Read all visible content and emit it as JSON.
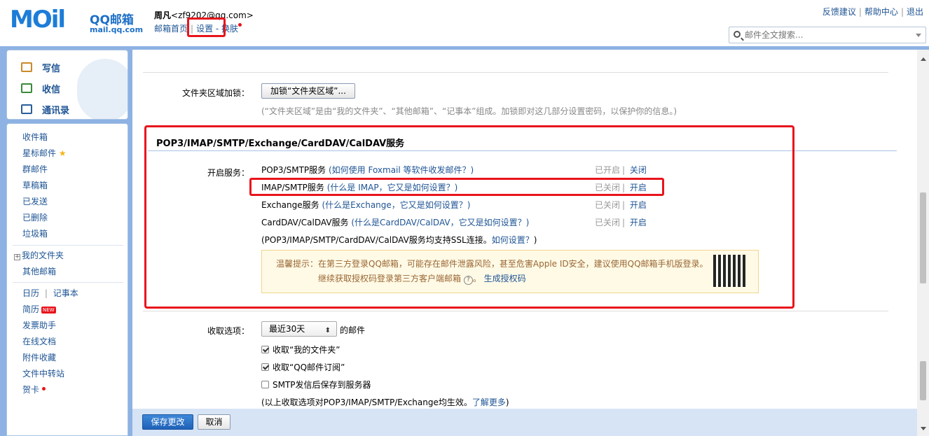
{
  "brand": {
    "mail_text": "MOil",
    "qq_mail": "QQ邮箱",
    "domain": "mail.qq.com"
  },
  "user": {
    "name": "周凡",
    "email": "<zf9202@qq.com>"
  },
  "toplinks": {
    "home": "邮箱首页",
    "settings": "设置",
    "skin": "换肤"
  },
  "rightlinks": {
    "feedback": "反馈建议",
    "help": "帮助中心",
    "logout": "退出"
  },
  "search": {
    "placeholder": "邮件全文搜索..."
  },
  "side": {
    "compose": "写信",
    "receive": "收信",
    "contacts": "通讯录",
    "items": {
      "inbox": "收件箱",
      "starred": "星标邮件",
      "group": "群邮件",
      "drafts": "草稿箱",
      "sent": "已发送",
      "deleted": "已删除",
      "spam": "垃圾箱",
      "myfolders": "我的文件夹",
      "othermail": "其他邮箱",
      "calendar": "日历",
      "notes": "记事本",
      "resume": "简历",
      "new_badge": "NEW",
      "invoice": "发票助手",
      "docs": "在线文档",
      "attachments": "附件收藏",
      "transfer": "文件中转站",
      "cards": "贺卡"
    }
  },
  "folder_lock": {
    "label": "文件夹区域加锁：",
    "button": "加锁“文件夹区域”...",
    "desc": "(“文件夹区域”是由“我的文件夹”、“其他邮箱”、“记事本”组成。加锁即对这几部分设置密码，以保护你的信息。)"
  },
  "services": {
    "title": "POP3/IMAP/SMTP/Exchange/CardDAV/CalDAV服务",
    "label": "开启服务：",
    "rows": [
      {
        "name": "POP3/SMTP服务",
        "hint": "(如何使用 Foxmail 等软件收发邮件？)",
        "state": "已开启",
        "action": "关闭"
      },
      {
        "name": "IMAP/SMTP服务",
        "hint": "(什么是 IMAP，它又是如何设置？)",
        "state": "已关闭",
        "action": "开启"
      },
      {
        "name": "Exchange服务",
        "hint": "(什么是Exchange，它又是如何设置？)",
        "state": "已关闭",
        "action": "开启"
      },
      {
        "name": "CardDAV/CalDAV服务",
        "hint": "(什么是CardDAV/CalDAV，它又是如何设置？)",
        "state": "已关闭",
        "action": "开启"
      }
    ],
    "ssl_note": "(POP3/IMAP/SMTP/CardDAV/CalDAV服务均支持SSL连接。",
    "ssl_link": "如何设置？",
    "ssl_close": ")",
    "tip_line1": "温馨提示：在第三方登录QQ邮箱，可能存在邮件泄露风险，甚至危害Apple ID安全，建议使用QQ邮箱手机版登录。",
    "tip_line2": "继续获取授权码登录第三方客户端邮箱",
    "tip_help": "?",
    "tip_link": "生成授权码"
  },
  "receive_options": {
    "label": "收取选项：",
    "select": "最近30天",
    "suffix": "的邮件",
    "opt1": "收取“我的文件夹”",
    "opt2": "收取“QQ邮件订阅”",
    "opt3": "SMTP发信后保存到服务器",
    "note": "(以上收取选项对POP3/IMAP/SMTP/Exchange均生效。",
    "note_link": "了解更多",
    "note_close": ")"
  },
  "buttons": {
    "save": "保存更改",
    "cancel": "取消"
  }
}
